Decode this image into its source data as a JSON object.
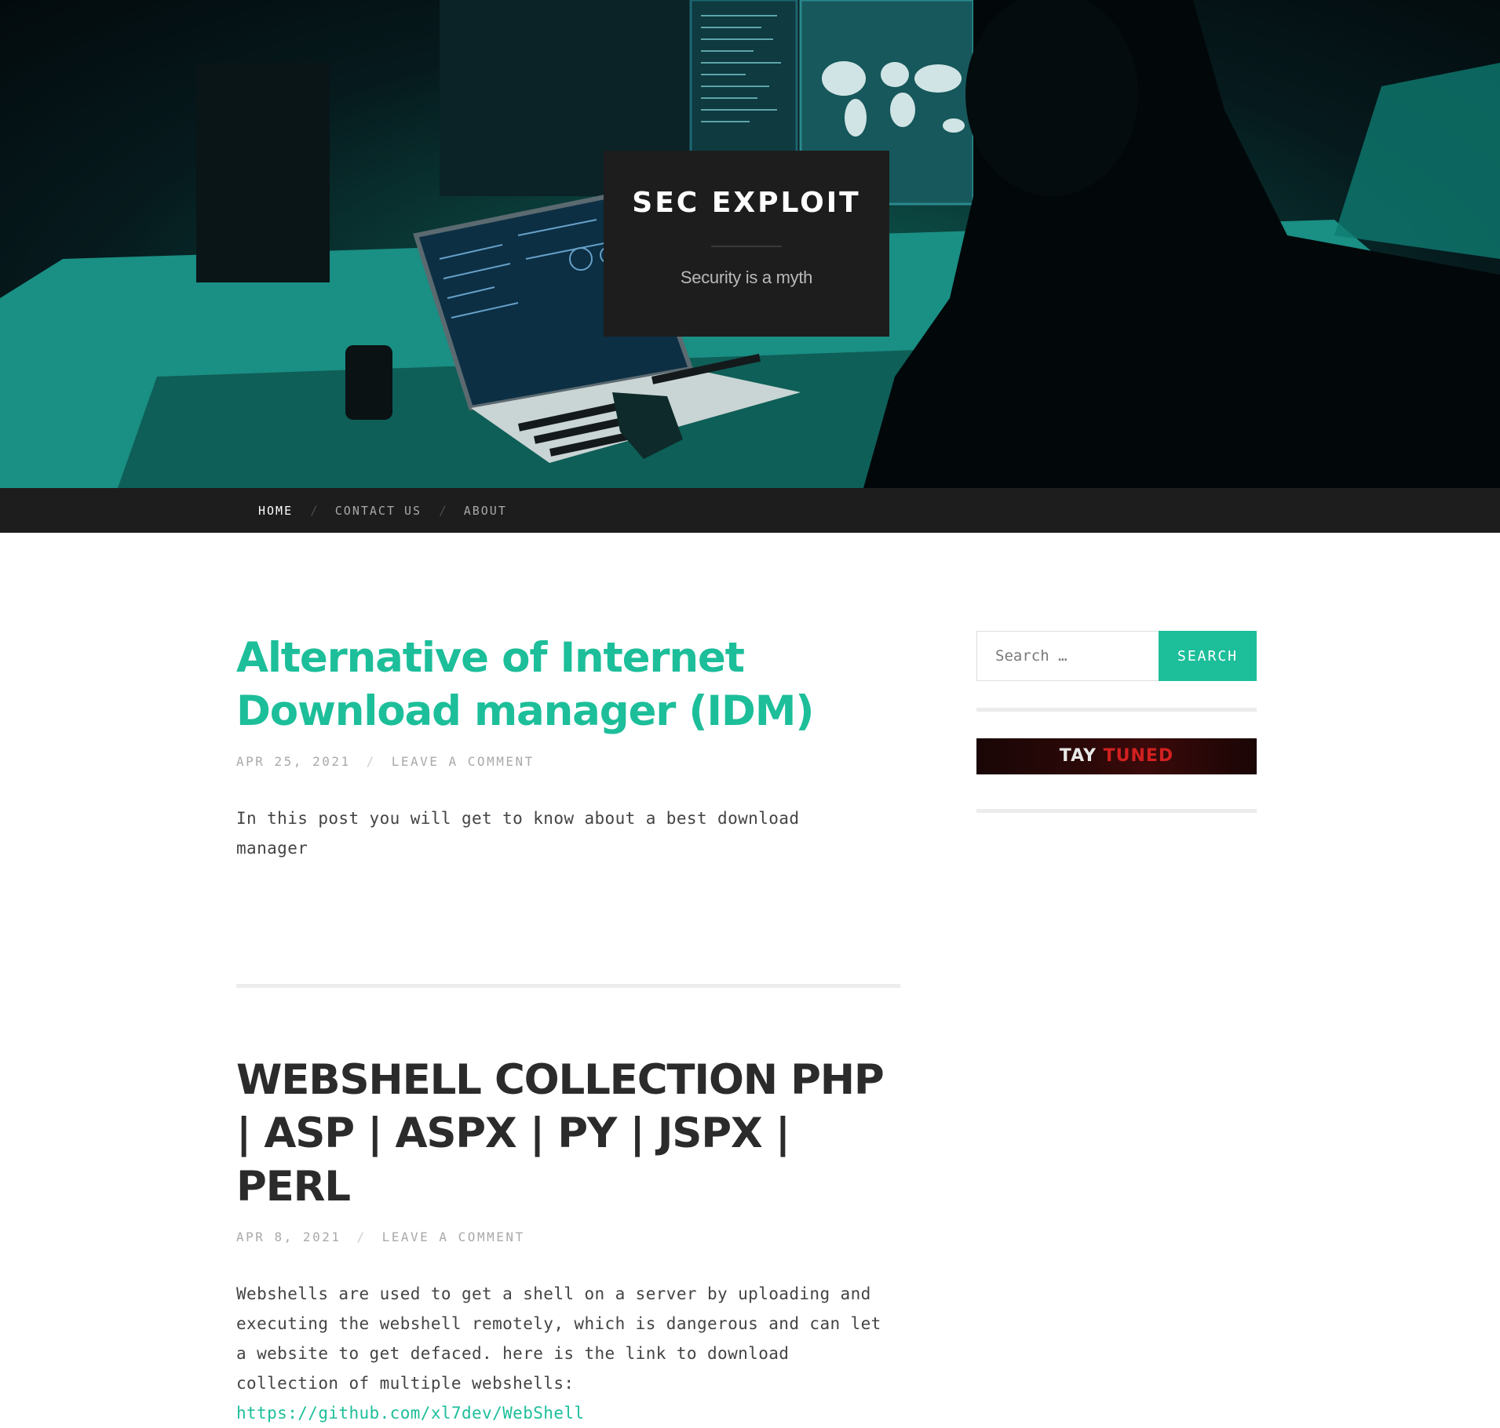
{
  "site": {
    "title": "SEC EXPLOIT",
    "tagline": "Security is a myth"
  },
  "nav": {
    "items": [
      {
        "label": "HOME",
        "active": true
      },
      {
        "label": "CONTACT US",
        "active": false
      },
      {
        "label": "ABOUT",
        "active": false
      }
    ],
    "separator": "/"
  },
  "posts": [
    {
      "title": "Alternative of Internet Download manager (IDM)",
      "date": "APR 25, 2021",
      "comment_link": "LEAVE A COMMENT",
      "excerpt": "In this post you will get to know about a best download manager"
    },
    {
      "title": "WEBSHELL COLLECTION PHP | ASP | ASPX | PY | JSPX | PERL",
      "date": "APR 8, 2021",
      "comment_link": "LEAVE A COMMENT",
      "excerpt": "Webshells are used to get a shell on a server by uploading and executing the webshell remotely, which is dangerous and can let a website to get defaced. here is the link to download collection of multiple webshells:",
      "link": "https://github.com/xl7dev/WebShell"
    }
  ],
  "sidebar": {
    "search_placeholder": "Search …",
    "search_button": "SEARCH",
    "banner_text_white": "TAY",
    "banner_text_red": "TUNED"
  },
  "colors": {
    "accent": "#1dbe9a",
    "dark_bar": "#1d1d1d"
  }
}
